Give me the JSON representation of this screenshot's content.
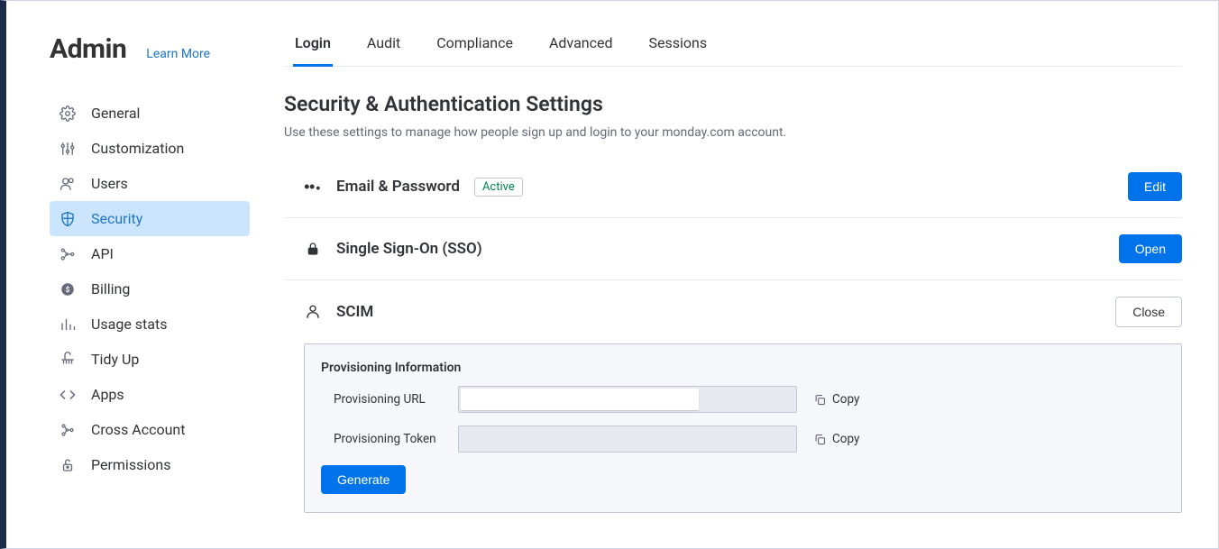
{
  "sidebar": {
    "title": "Admin",
    "learn_more": "Learn More",
    "items": [
      {
        "label": "General"
      },
      {
        "label": "Customization"
      },
      {
        "label": "Users"
      },
      {
        "label": "Security"
      },
      {
        "label": "API"
      },
      {
        "label": "Billing"
      },
      {
        "label": "Usage stats"
      },
      {
        "label": "Tidy Up"
      },
      {
        "label": "Apps"
      },
      {
        "label": "Cross Account"
      },
      {
        "label": "Permissions"
      }
    ]
  },
  "tabs": {
    "login": "Login",
    "audit": "Audit",
    "compliance": "Compliance",
    "advanced": "Advanced",
    "sessions": "Sessions"
  },
  "page": {
    "title": "Security & Authentication Settings",
    "subtitle": "Use these settings to manage how people sign up and login to your monday.com account."
  },
  "sections": {
    "email_pw": {
      "title": "Email & Password",
      "badge": "Active",
      "button": "Edit"
    },
    "sso": {
      "title": "Single Sign-On (SSO)",
      "button": "Open"
    },
    "scim": {
      "title": "SCIM",
      "button": "Close"
    }
  },
  "scim_panel": {
    "title": "Provisioning Information",
    "url_label": "Provisioning URL",
    "url_value": "",
    "token_label": "Provisioning Token",
    "token_value": "",
    "copy": "Copy",
    "generate": "Generate"
  }
}
